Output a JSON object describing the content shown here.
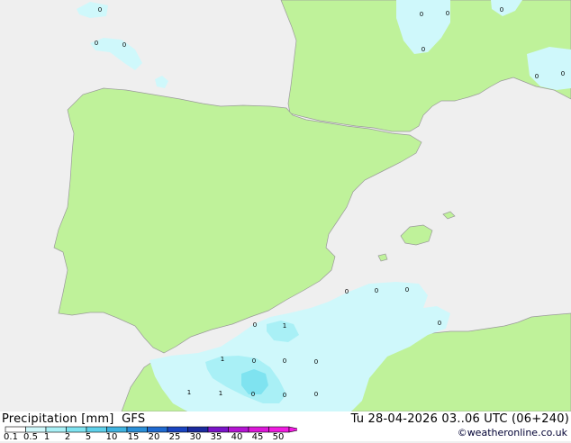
{
  "legend": {
    "title": "Precipitation [mm]",
    "model": "GFS",
    "valid_time": "Tu 28-04-2026 03..06 UTC (06+240)",
    "credit": "©weatheronline.co.uk",
    "scale_values": [
      "0.1",
      "0.5",
      "1",
      "2",
      "5",
      "10",
      "15",
      "20",
      "25",
      "30",
      "35",
      "40",
      "45",
      "50"
    ],
    "scale_colors": [
      "#ffffff",
      "#cff8fb",
      "#a9f0f6",
      "#7fe3f0",
      "#5ed0ea",
      "#3fb3e0",
      "#2a8fd8",
      "#1f6ad0",
      "#1a44c0",
      "#1b2a9e",
      "#7a14c8",
      "#b414d2",
      "#dc18d8",
      "#f01ce0"
    ]
  },
  "colors": {
    "land": "#bff29a",
    "sea": "#efefef",
    "border": "#9a9a9a",
    "rain_light": "#cff8fb",
    "rain_medium": "#a9f0f6"
  },
  "map_labels": [
    {
      "text": "0"
    },
    {
      "text": "0"
    },
    {
      "text": "0"
    },
    {
      "text": "0"
    },
    {
      "text": "0"
    },
    {
      "text": "0"
    },
    {
      "text": "0"
    },
    {
      "text": "0"
    },
    {
      "text": "0"
    },
    {
      "text": "0"
    },
    {
      "text": "0"
    },
    {
      "text": "0"
    },
    {
      "text": "0"
    },
    {
      "text": "0"
    },
    {
      "text": "1"
    },
    {
      "text": "1"
    },
    {
      "text": "0"
    },
    {
      "text": "0"
    },
    {
      "text": "0"
    },
    {
      "text": "1"
    },
    {
      "text": "1"
    },
    {
      "text": "0"
    },
    {
      "text": "0"
    },
    {
      "text": "0"
    }
  ]
}
